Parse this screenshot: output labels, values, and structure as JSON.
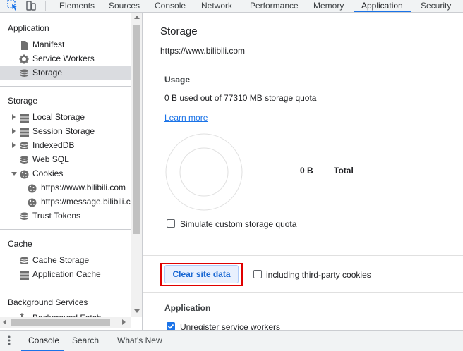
{
  "toolbar": {
    "tabs": [
      {
        "label": "Elements"
      },
      {
        "label": "Sources"
      },
      {
        "label": "Console"
      },
      {
        "label": "Network"
      },
      {
        "label": "Performance"
      },
      {
        "label": "Memory"
      },
      {
        "label": "Application"
      },
      {
        "label": "Security"
      }
    ],
    "active_tab": "Application"
  },
  "sidebar": {
    "application_title": "Application",
    "application_items": [
      {
        "label": "Manifest",
        "icon": "file-icon"
      },
      {
        "label": "Service Workers",
        "icon": "gear-icon"
      },
      {
        "label": "Storage",
        "icon": "database-icon"
      }
    ],
    "storage_title": "Storage",
    "storage_items": [
      {
        "label": "Local Storage",
        "icon": "grid-icon"
      },
      {
        "label": "Session Storage",
        "icon": "grid-icon"
      },
      {
        "label": "IndexedDB",
        "icon": "database-icon"
      },
      {
        "label": "Web SQL",
        "icon": "database-icon"
      },
      {
        "label": "Cookies",
        "icon": "cookie-icon"
      },
      {
        "label": "https://www.bilibili.com",
        "icon": "cookie-icon"
      },
      {
        "label": "https://message.bilibili.c",
        "icon": "cookie-icon"
      },
      {
        "label": "Trust Tokens",
        "icon": "database-icon"
      }
    ],
    "cache_title": "Cache",
    "cache_items": [
      {
        "label": "Cache Storage",
        "icon": "database-icon"
      },
      {
        "label": "Application Cache",
        "icon": "grid-icon"
      }
    ],
    "background_title": "Background Services",
    "background_partial": "Background Fetch"
  },
  "main": {
    "title": "Storage",
    "origin": "https://www.bilibili.com",
    "usage": {
      "heading": "Usage",
      "text": "0 B used out of 77310 MB storage quota",
      "learn_more": "Learn more",
      "total_value": "0 B",
      "total_label": "Total",
      "simulate_label": "Simulate custom storage quota"
    },
    "clear_button": "Clear site data",
    "third_party_label": "including third-party cookies",
    "application_heading": "Application",
    "unregister_label": "Unregister service workers"
  },
  "drawer": {
    "tabs": [
      {
        "label": "Console"
      },
      {
        "label": "Search"
      },
      {
        "label": "What's New"
      }
    ],
    "active_tab": "Console"
  },
  "colors": {
    "accent": "#1a73e8",
    "highlight_outline": "#e00000",
    "selected_bg": "#dadce0"
  }
}
